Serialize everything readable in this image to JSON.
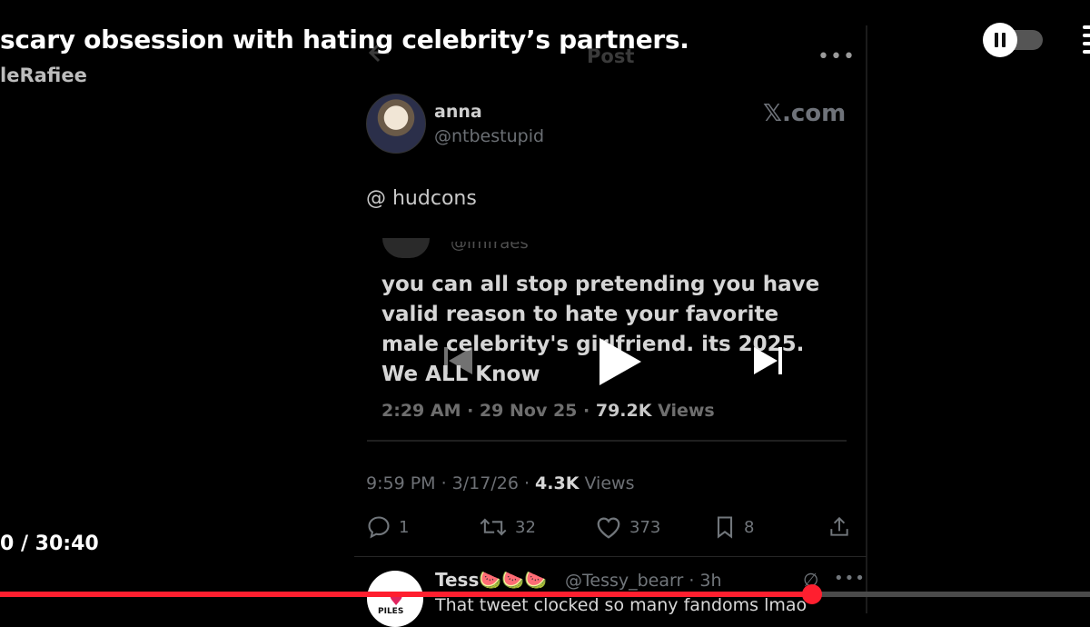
{
  "player": {
    "title": "scary obsession with hating celebrity’s partners.",
    "channel": "leRafiee",
    "time": "0 / 30:40",
    "progress": 0.745,
    "accent": "#ff1f2f"
  },
  "post": {
    "header": "Post",
    "author_name": "anna",
    "author_handle": "@ntbestupid",
    "source": "𝕏.com",
    "text": "@ hudcons",
    "quoted": {
      "handle": "@lmfraes",
      "text": "you can all stop pretending you have valid reason to hate your favorite male celebrity's girlfriend. its 2025. We ALL Know",
      "meta_prefix": "2:29 AM · 29 Nov 25 · ",
      "views_count": "79.2K",
      "views_label": " Views"
    },
    "meta_prefix": "9:59 PM · 3/17/26 · ",
    "views_count": "4.3K",
    "views_label": " Views",
    "actions": {
      "replies": "1",
      "reposts": "32",
      "likes": "373",
      "bookmarks": "8"
    }
  },
  "reply": {
    "name": "Tess🍉🍉🍉",
    "handle_time": "@Tessy_bearr · 3h",
    "text": "That tweet clocked so many fandoms lmao",
    "avatar_text": "PILES"
  }
}
